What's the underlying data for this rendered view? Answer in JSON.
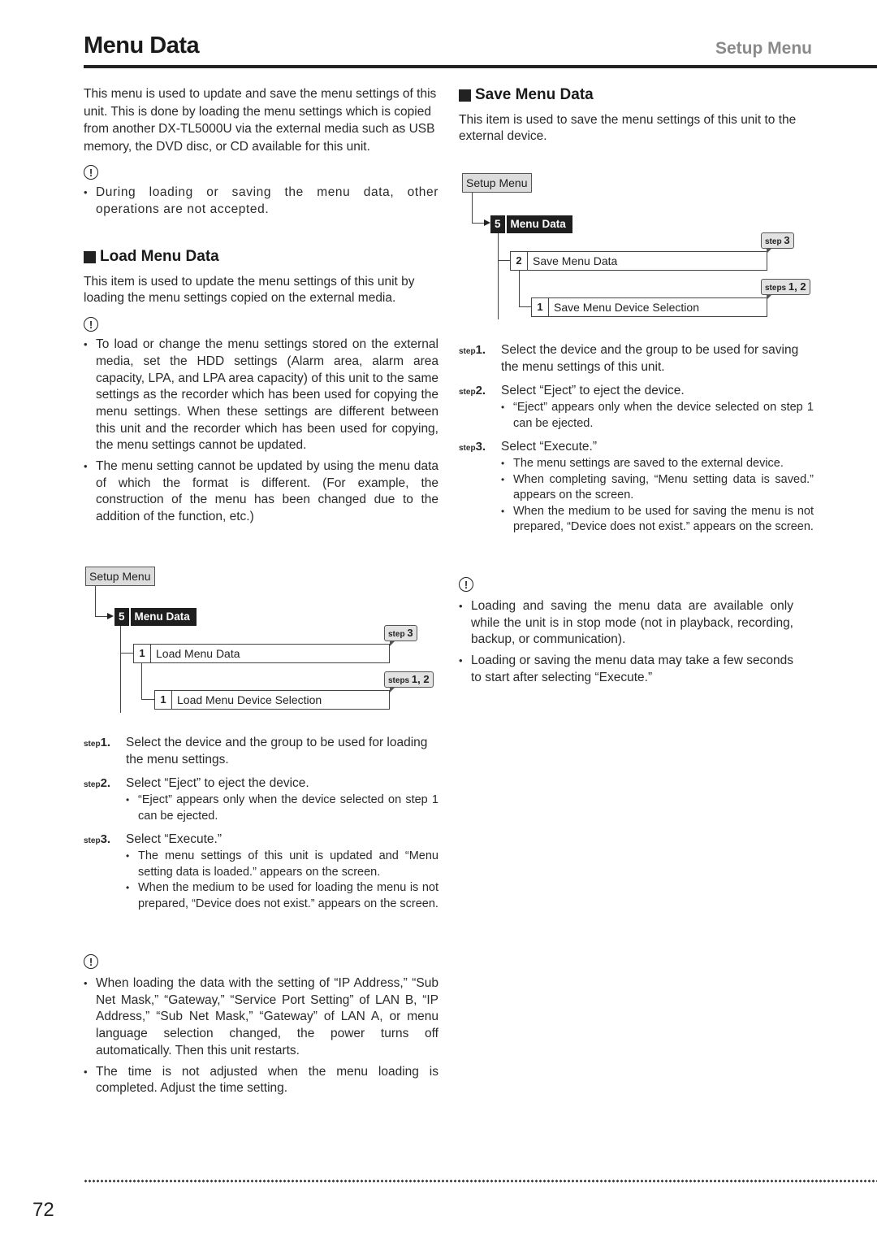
{
  "header": {
    "title": "Menu Data",
    "section": "Setup Menu"
  },
  "intro": {
    "text": "This menu is used to update and save the menu settings of this unit. This is done by loading the menu settings which is copied from another DX-TL5000U via the external media such as USB memory, the DVD disc, or CD available for this unit.",
    "notice_icon": "!",
    "notes": [
      "During loading or saving the menu data, other operations are not accepted."
    ]
  },
  "load": {
    "heading": "Load Menu Data",
    "description": "This item is used to update the menu settings of this unit by loading the menu settings copied on the external media.",
    "notice_icon": "!",
    "notes": [
      "To load or change the menu settings stored on the external media, set the HDD settings (Alarm area, alarm area capacity, LPA, and LPA area capacity) of this unit to the same settings as the recorder which has been used for copying the menu settings. When these settings are different between this unit and the recorder which has been used for copying, the menu settings cannot be updated.",
      "The menu setting cannot be updated by using the menu data of which the format is different. (For example, the construction of the menu has been changed due to the addition of the function, etc.)"
    ],
    "diagram": {
      "root": "Setup Menu",
      "menu_num": "5",
      "menu_label": "Menu Data",
      "item_num": "1",
      "item_label": "Load Menu Data",
      "item_callout_prefix": "step",
      "item_callout_steps": "3",
      "sub_num": "1",
      "sub_label": "Load Menu Device Selection",
      "sub_callout_prefix": "steps",
      "sub_callout_steps": "1, 2"
    },
    "steps": [
      {
        "prefix": "step",
        "num": "1.",
        "text": "Select the device and the group to be used for loading the menu settings.",
        "subs": []
      },
      {
        "prefix": "step",
        "num": "2.",
        "text": "Select “Eject” to eject the device.",
        "subs": [
          "“Eject” appears only when the device selected on step 1 can be ejected."
        ]
      },
      {
        "prefix": "step",
        "num": "3.",
        "text": "Select “Execute.”",
        "subs": [
          "The menu settings of this unit is updated and “Menu setting data is loaded.” appears on the screen.",
          "When the medium to be used for loading the menu is not prepared, “Device does not exist.” appears on the screen."
        ]
      }
    ],
    "notice2_icon": "!",
    "notes2": [
      "When loading the data with the setting of “IP Address,” “Sub Net Mask,” “Gateway,” “Service Port Setting” of LAN B, “IP Address,” “Sub Net Mask,” “Gateway” of LAN A, or menu language selection changed, the power turns off automatically. Then this unit restarts.",
      "The time is not adjusted when the menu loading is completed. Adjust the time setting."
    ]
  },
  "save": {
    "heading": "Save Menu Data",
    "description": "This item is used to save the menu settings of this unit to the external device.",
    "diagram": {
      "root": "Setup Menu",
      "menu_num": "5",
      "menu_label": "Menu Data",
      "item_num": "2",
      "item_label": "Save Menu Data",
      "item_callout_prefix": "step",
      "item_callout_steps": "3",
      "sub_num": "1",
      "sub_label": "Save Menu Device Selection",
      "sub_callout_prefix": "steps",
      "sub_callout_steps": "1, 2"
    },
    "steps": [
      {
        "prefix": "step",
        "num": "1.",
        "text": "Select the device and the group to be used for saving the menu settings of this unit.",
        "subs": []
      },
      {
        "prefix": "step",
        "num": "2.",
        "text": "Select “Eject” to eject the device.",
        "subs": [
          "“Eject” appears only when the device selected on step 1 can be ejected."
        ]
      },
      {
        "prefix": "step",
        "num": "3.",
        "text": "Select “Execute.”",
        "subs": [
          "The menu settings are saved to the external device.",
          "When completing saving, “Menu setting data is saved.” appears on the screen.",
          "When the medium to be used for saving the menu is not prepared, “Device does not exist.” appears on the screen."
        ]
      }
    ],
    "notice_icon": "!",
    "notes": [
      "Loading and saving the menu data are available only while the unit is in stop mode (not in playback, recording, backup, or communication).",
      "Loading or saving the menu data may take a few seconds to start after selecting “Execute.”"
    ]
  },
  "footer": {
    "page_number": "72"
  }
}
